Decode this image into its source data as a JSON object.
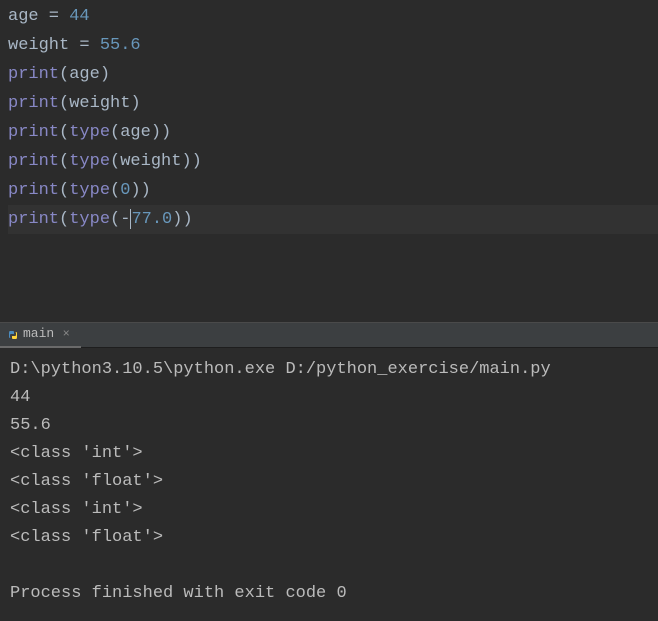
{
  "editor": {
    "lines": [
      {
        "tokens": [
          {
            "t": "identifier",
            "v": "age"
          },
          {
            "t": "operator",
            "v": " = "
          },
          {
            "t": "number",
            "v": "44"
          }
        ]
      },
      {
        "tokens": [
          {
            "t": "identifier",
            "v": "weight"
          },
          {
            "t": "operator",
            "v": " = "
          },
          {
            "t": "number",
            "v": "55.6"
          }
        ]
      },
      {
        "tokens": [
          {
            "t": "builtin",
            "v": "print"
          },
          {
            "t": "paren",
            "v": "("
          },
          {
            "t": "identifier",
            "v": "age"
          },
          {
            "t": "paren",
            "v": ")"
          }
        ]
      },
      {
        "tokens": [
          {
            "t": "builtin",
            "v": "print"
          },
          {
            "t": "paren",
            "v": "("
          },
          {
            "t": "identifier",
            "v": "weight"
          },
          {
            "t": "paren",
            "v": ")"
          }
        ]
      },
      {
        "tokens": [
          {
            "t": "builtin",
            "v": "print"
          },
          {
            "t": "paren",
            "v": "("
          },
          {
            "t": "builtin",
            "v": "type"
          },
          {
            "t": "paren",
            "v": "("
          },
          {
            "t": "identifier",
            "v": "age"
          },
          {
            "t": "paren",
            "v": "))"
          }
        ]
      },
      {
        "tokens": [
          {
            "t": "builtin",
            "v": "print"
          },
          {
            "t": "paren",
            "v": "("
          },
          {
            "t": "builtin",
            "v": "type"
          },
          {
            "t": "paren",
            "v": "("
          },
          {
            "t": "identifier",
            "v": "weight"
          },
          {
            "t": "paren",
            "v": "))"
          }
        ]
      },
      {
        "tokens": [
          {
            "t": "builtin",
            "v": "print"
          },
          {
            "t": "paren",
            "v": "("
          },
          {
            "t": "builtin",
            "v": "type"
          },
          {
            "t": "paren",
            "v": "("
          },
          {
            "t": "number",
            "v": "0"
          },
          {
            "t": "paren",
            "v": "))"
          }
        ]
      },
      {
        "tokens": [
          {
            "t": "builtin",
            "v": "print"
          },
          {
            "t": "paren",
            "v": "("
          },
          {
            "t": "builtin",
            "v": "type"
          },
          {
            "t": "paren",
            "v": "(-"
          },
          {
            "t": "number",
            "v": "77.0"
          },
          {
            "t": "paren",
            "v": "))"
          }
        ],
        "highlighted": true,
        "cursorAfter": 3
      }
    ]
  },
  "tab": {
    "label": "main"
  },
  "console": {
    "lines": [
      "D:\\python3.10.5\\python.exe D:/python_exercise/main.py",
      "44",
      "55.6",
      "<class 'int'>",
      "<class 'float'>",
      "<class 'int'>",
      "<class 'float'>",
      "",
      "Process finished with exit code 0"
    ]
  }
}
